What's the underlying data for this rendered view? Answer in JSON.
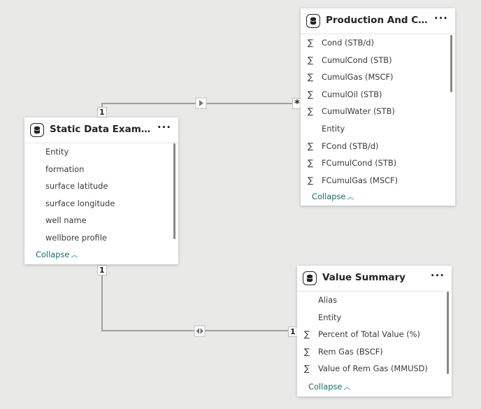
{
  "tables": {
    "production": {
      "title": "Production And Compl...",
      "more": "···",
      "fields": [
        {
          "label": "Cond (STB/d)",
          "sigma": true
        },
        {
          "label": "CumulCond (STB)",
          "sigma": true
        },
        {
          "label": "CumulGas (MSCF)",
          "sigma": true
        },
        {
          "label": "CumulOil (STB)",
          "sigma": true
        },
        {
          "label": "CumulWater (STB)",
          "sigma": true
        },
        {
          "label": "Entity",
          "sigma": false
        },
        {
          "label": "FCond (STB/d)",
          "sigma": true
        },
        {
          "label": "FCumulCond (STB)",
          "sigma": true
        },
        {
          "label": "FCumulGas (MSCF)",
          "sigma": true
        }
      ],
      "collapse_label": "Collapse"
    },
    "static": {
      "title": "Static Data Example",
      "more": "···",
      "fields": [
        {
          "label": "Entity",
          "sigma": false
        },
        {
          "label": "formation",
          "sigma": false
        },
        {
          "label": "surface latitude",
          "sigma": false
        },
        {
          "label": "surface longitude",
          "sigma": false
        },
        {
          "label": "well name",
          "sigma": false
        },
        {
          "label": "wellbore profile",
          "sigma": false
        }
      ],
      "collapse_label": "Collapse"
    },
    "value": {
      "title": "Value Summary",
      "more": "···",
      "fields": [
        {
          "label": "Alias",
          "sigma": false
        },
        {
          "label": "Entity",
          "sigma": false
        },
        {
          "label": "Percent of Total Value (%)",
          "sigma": true
        },
        {
          "label": "Rem Gas (BSCF)",
          "sigma": true
        },
        {
          "label": "Value of Rem Gas (MMUSD)",
          "sigma": true
        }
      ],
      "collapse_label": "Collapse"
    }
  },
  "relationships": {
    "static_production": {
      "from_cardinality": "1",
      "to_cardinality": "*",
      "direction": "single"
    },
    "static_value": {
      "from_cardinality": "1",
      "to_cardinality": "1",
      "direction": "both"
    }
  },
  "icons": {
    "table": "table-database-icon",
    "sum": "sigma-icon",
    "more": "more-options-icon",
    "collapse": "chevron-up-icon",
    "filter_single": "single-direction-arrow-icon",
    "filter_both": "bidirectional-arrow-icon"
  },
  "colors": {
    "link": "#1a6b6e",
    "canvas": "#e9e9e8",
    "card": "#ffffff"
  }
}
